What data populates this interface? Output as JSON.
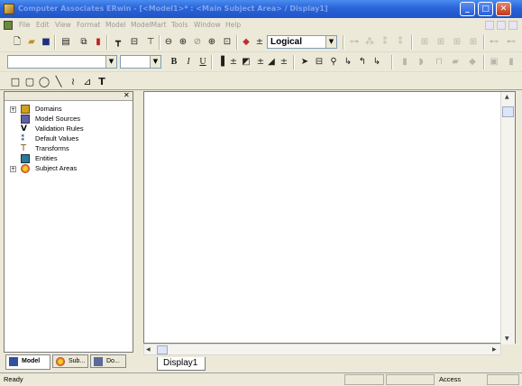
{
  "window": {
    "title": "Computer Associates ERwin - [<Model1>* : <Main Subject Area> / Display1]",
    "min": "_",
    "max": "□",
    "close": "✕"
  },
  "menu": {
    "items": [
      "File",
      "Edit",
      "View",
      "Format",
      "Model",
      "ModelMart",
      "Tools",
      "Window",
      "Help"
    ]
  },
  "toolbar1": {
    "view_combo_value": "Logical",
    "icons": [
      "new-icon",
      "open-icon",
      "save-icon",
      "print-icon",
      "copy-icon",
      "paste-icon",
      "table-icon",
      "columns-icon",
      "display-icon",
      "zoom-out-icon",
      "zoom-in-icon",
      "zoom-fit-icon",
      "zoom-area-icon",
      "zoom-page-icon",
      "model-icon"
    ]
  },
  "toolbar2": {
    "font_combo_value": "",
    "size_combo_value": "",
    "bold": "B",
    "italic": "I",
    "underline": "U"
  },
  "toolbar3": {
    "text_tool": "T"
  },
  "tree": {
    "items": [
      {
        "label": "Domains",
        "expandable": true,
        "color": "#d0a020"
      },
      {
        "label": "Model Sources",
        "expandable": false,
        "color": "#6060a0"
      },
      {
        "label": "Validation Rules",
        "expandable": false,
        "color": "#303030"
      },
      {
        "label": "Default Values",
        "expandable": false,
        "color": "#2a4a8a"
      },
      {
        "label": "Transforms",
        "expandable": false,
        "color": "#806020"
      },
      {
        "label": "Entities",
        "expandable": false,
        "color": "#2a7a9a"
      },
      {
        "label": "Subject Areas",
        "expandable": true,
        "color": "#c03030"
      }
    ]
  },
  "left_tabs": [
    {
      "label": "Model",
      "active": true
    },
    {
      "label": "Sub...",
      "active": false
    },
    {
      "label": "Do...",
      "active": false
    }
  ],
  "diagram": {
    "tab_label": "Display1"
  },
  "status": {
    "ready": "Ready",
    "access": "Access"
  }
}
